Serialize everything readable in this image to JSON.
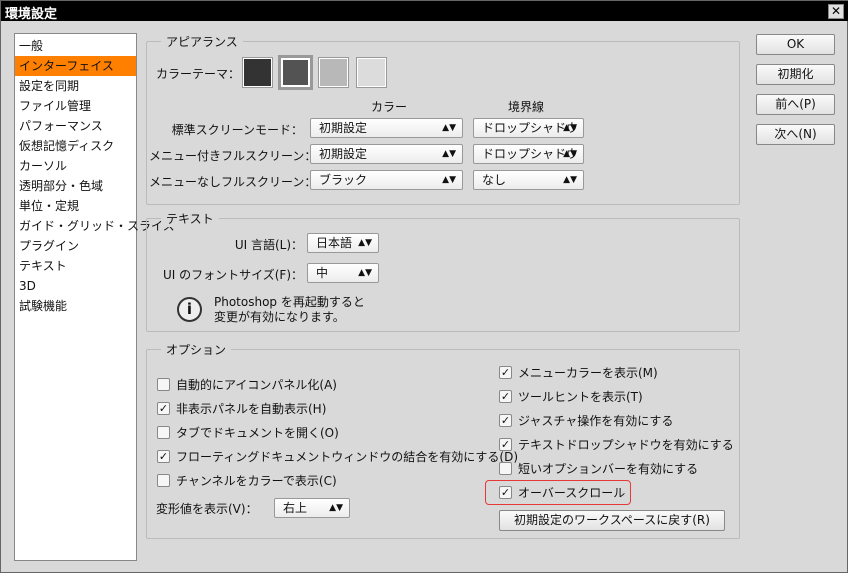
{
  "window": {
    "title": "環境設定",
    "close": "✕"
  },
  "sidebar": {
    "items": [
      "一般",
      "インターフェイス",
      "設定を同期",
      "ファイル管理",
      "パフォーマンス",
      "仮想記憶ディスク",
      "カーソル",
      "透明部分・色域",
      "単位・定規",
      "ガイド・グリッド・スライス",
      "プラグイン",
      "テキスト",
      "3D",
      "試験機能"
    ],
    "selected": 1
  },
  "buttons": {
    "ok": "OK",
    "reset": "初期化",
    "prev": "前へ(P)",
    "next": "次へ(N)"
  },
  "appearance": {
    "legend": "アピアランス",
    "theme_label": "カラーテーマ：",
    "themes": [
      "#333333",
      "#535353",
      "#b8b8b8",
      "#dcdcdc"
    ],
    "theme_selected": 1,
    "col_color": "カラー",
    "col_border": "境界線",
    "rows": [
      {
        "label": "標準スクリーンモード：",
        "color": "初期設定",
        "border": "ドロップシャドウ"
      },
      {
        "label": "メニュー付きフルスクリーン：",
        "color": "初期設定",
        "border": "ドロップシャドウ"
      },
      {
        "label": "メニューなしフルスクリーン：",
        "color": "ブラック",
        "border": "なし"
      }
    ]
  },
  "text": {
    "legend": "テキスト",
    "lang_label": "UI 言語(L)：",
    "lang": "日本語",
    "size_label": "UI のフォントサイズ(F)：",
    "size": "中",
    "info_line1": "Photoshop を再起動すると",
    "info_line2": "変更が有効になります。"
  },
  "options": {
    "legend": "オプション",
    "left": [
      {
        "label": "自動的にアイコンパネル化(A)",
        "checked": false
      },
      {
        "label": "非表示パネルを自動表示(H)",
        "checked": true
      },
      {
        "label": "タブでドキュメントを開く(O)",
        "checked": false
      },
      {
        "label": "フローティングドキュメントウィンドウの結合を有効にする(D)",
        "checked": true
      },
      {
        "label": "チャンネルをカラーで表示(C)",
        "checked": false
      }
    ],
    "transform_label": "変形値を表示(V)：",
    "transform": "右上",
    "right": [
      {
        "label": "メニューカラーを表示(M)",
        "checked": true
      },
      {
        "label": "ツールヒントを表示(T)",
        "checked": true
      },
      {
        "label": "ジャスチャ操作を有効にする",
        "checked": true
      },
      {
        "label": "テキストドロップシャドウを有効にする",
        "checked": true
      },
      {
        "label": "短いオプションバーを有効にする",
        "checked": false
      },
      {
        "label": "オーバースクロール",
        "checked": true
      }
    ],
    "reset_workspace": "初期設定のワークスペースに戻す(R)",
    "highlight_color": "#e53935"
  }
}
